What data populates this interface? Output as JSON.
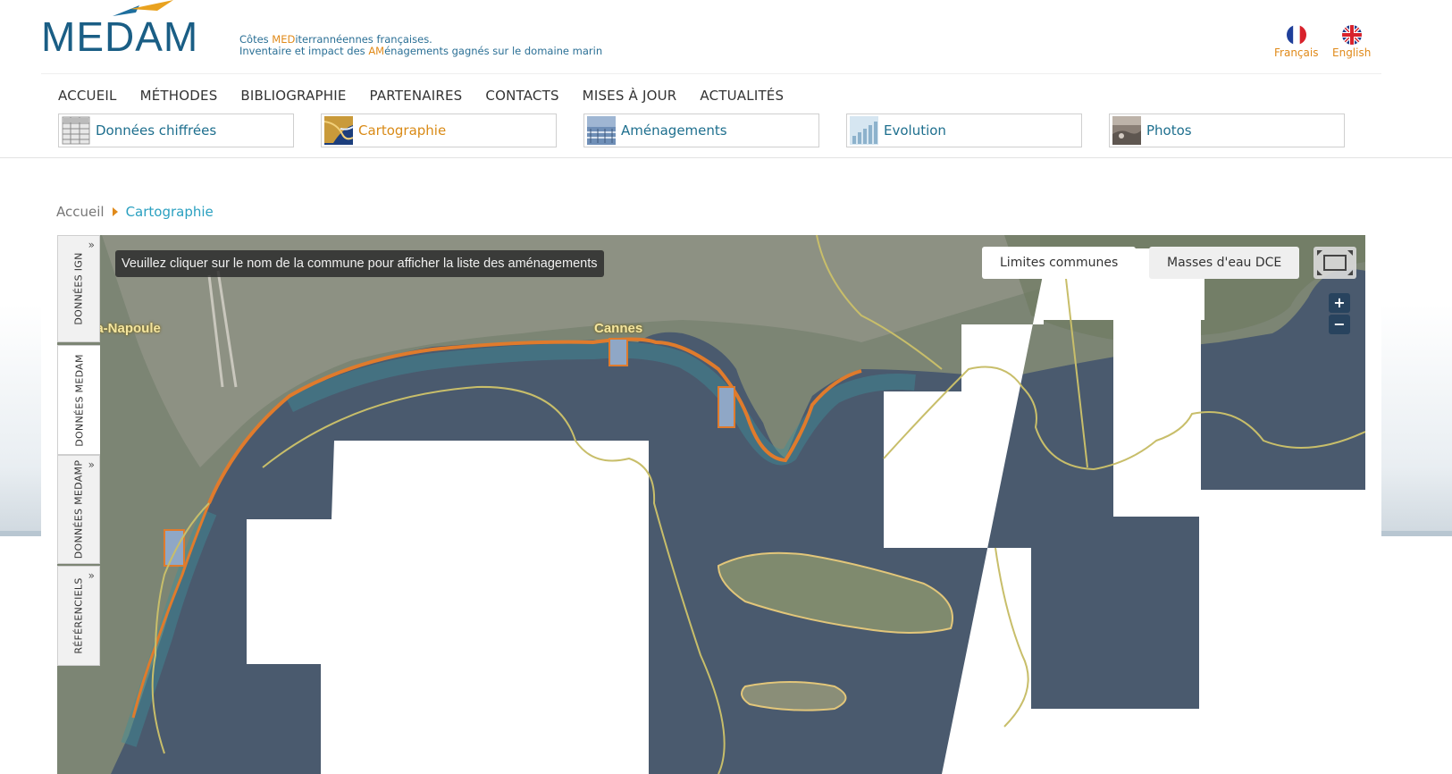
{
  "brand": {
    "logo_text": "MEDAM",
    "tagline_line1_pre": "Côtes ",
    "tagline_line1_hl": "MED",
    "tagline_line1_post": "iterrannéennes françaises.",
    "tagline_line2_pre": "Inventaire et impact des ",
    "tagline_line2_hl": "AM",
    "tagline_line2_post": "énagements gagnés sur le domaine marin",
    "colors": {
      "logo": "#1a5e85",
      "accent": "#e08a1a",
      "link": "#1e6f8e"
    }
  },
  "languages": [
    {
      "label": "Français",
      "icon": "flag-fr-icon"
    },
    {
      "label": "English",
      "icon": "flag-uk-icon"
    }
  ],
  "main_nav": [
    "ACCUEIL",
    "MÉTHODES",
    "BIBLIOGRAPHIE",
    "PARTENAIRES",
    "CONTACTS",
    "MISES À JOUR",
    "ACTUALITÉS"
  ],
  "sub_nav": [
    {
      "label": "Données chiffrées",
      "active": false
    },
    {
      "label": "Cartographie",
      "active": true
    },
    {
      "label": "Aménagements",
      "active": false
    },
    {
      "label": "Evolution",
      "active": false
    },
    {
      "label": "Photos",
      "active": false
    }
  ],
  "breadcrumb": {
    "home": "Accueil",
    "current": "Cartographie"
  },
  "map": {
    "info_message": "Veuillez cliquer sur le nom de la commune pour afficher la liste des aménagements",
    "layer_buttons": [
      "Limites communes",
      "Masses d'eau DCE"
    ],
    "side_tabs": [
      "DONNÉES IGN",
      "DONNÉES MEDAM",
      "DONNÉES MEDAMP",
      "RÉFÉRENCIELS"
    ],
    "side_tab_toggle": "»",
    "zoom_in": "+",
    "zoom_out": "−",
    "place_labels": [
      "elieu-la-Napoule",
      "Cannes"
    ]
  }
}
